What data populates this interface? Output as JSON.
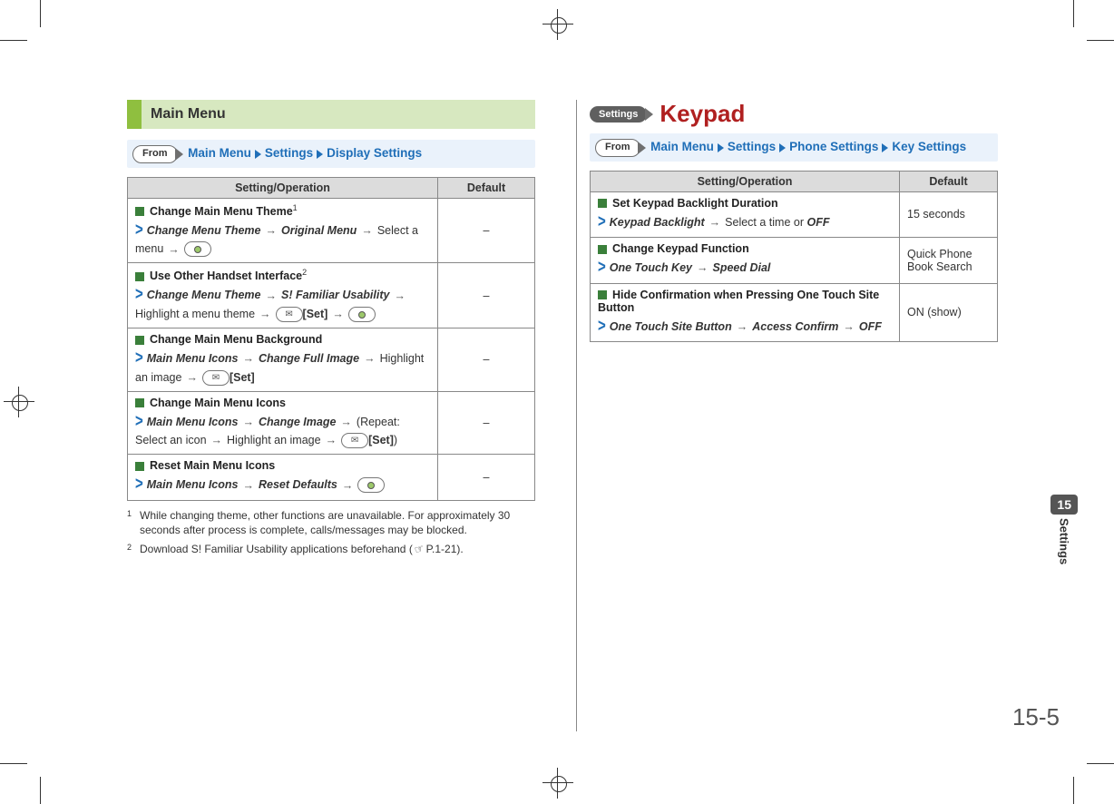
{
  "left": {
    "section_title": "Main Menu",
    "from_label": "From",
    "breadcrumb": [
      "Main Menu",
      "Settings",
      "Display Settings"
    ],
    "table": {
      "headers": [
        "Setting/Operation",
        "Default"
      ],
      "rows": [
        {
          "title": "Change Main Menu Theme",
          "title_sup": "1",
          "path": [
            {
              "t": "Change Menu Theme",
              "s": "bi"
            },
            {
              "t": "→"
            },
            {
              "t": "Original Menu",
              "s": "bi"
            },
            {
              "t": "→"
            },
            {
              "t": "Select a menu"
            },
            {
              "t": "→"
            },
            {
              "t": "[center]",
              "s": "btn-center"
            }
          ],
          "default": "–"
        },
        {
          "title": "Use Other Handset Interface",
          "title_sup": "2",
          "path": [
            {
              "t": "Change Menu Theme",
              "s": "bi"
            },
            {
              "t": "→"
            },
            {
              "t": "S! Familiar Usability",
              "s": "bi"
            },
            {
              "t": "→"
            },
            {
              "t": "Highlight a menu theme"
            },
            {
              "t": "→"
            },
            {
              "t": "[mail]",
              "s": "btn-mail"
            },
            {
              "t": "[Set]",
              "s": "b"
            },
            {
              "t": "→"
            },
            {
              "t": "[center]",
              "s": "btn-center"
            }
          ],
          "default": "–"
        },
        {
          "title": "Change Main Menu Background",
          "path": [
            {
              "t": "Main Menu Icons",
              "s": "bi"
            },
            {
              "t": "→"
            },
            {
              "t": "Change Full Image",
              "s": "bi"
            },
            {
              "t": "→"
            },
            {
              "t": "Highlight an image"
            },
            {
              "t": "→"
            },
            {
              "t": "[mail]",
              "s": "btn-mail"
            },
            {
              "t": "[Set]",
              "s": "b"
            }
          ],
          "default": "–"
        },
        {
          "title": "Change Main Menu Icons",
          "path": [
            {
              "t": "Main Menu Icons",
              "s": "bi"
            },
            {
              "t": "→"
            },
            {
              "t": "Change Image",
              "s": "bi"
            },
            {
              "t": "→"
            },
            {
              "t": "(Repeat: Select an icon"
            },
            {
              "t": "→"
            },
            {
              "t": "Highlight an image"
            },
            {
              "t": "→"
            },
            {
              "t": "[mail]",
              "s": "btn-mail"
            },
            {
              "t": "[Set]",
              "s": "b"
            },
            {
              "t": ")"
            }
          ],
          "default": "–"
        },
        {
          "title": "Reset Main Menu Icons",
          "path": [
            {
              "t": "Main Menu Icons",
              "s": "bi"
            },
            {
              "t": "→"
            },
            {
              "t": "Reset Defaults",
              "s": "bi"
            },
            {
              "t": "→"
            },
            {
              "t": "[center]",
              "s": "btn-center"
            }
          ],
          "default": "–"
        }
      ]
    },
    "footnotes": [
      {
        "num": "1",
        "text_a": "While changing theme, other functions are unavailable. For approximately 30 seconds after process is complete, calls/messages may be blocked."
      },
      {
        "num": "2",
        "text_a": "Download S! Familiar Usability applications beforehand (",
        "hand": true,
        "text_b": "P.1-21)."
      }
    ]
  },
  "right": {
    "settings_pill": "Settings",
    "page_title": "Keypad",
    "from_label": "From",
    "breadcrumb": [
      "Main Menu",
      "Settings",
      "Phone Settings",
      "Key Settings"
    ],
    "table": {
      "headers": [
        "Setting/Operation",
        "Default"
      ],
      "rows": [
        {
          "title": "Set Keypad Backlight Duration",
          "path": [
            {
              "t": "Keypad Backlight",
              "s": "bi"
            },
            {
              "t": "→"
            },
            {
              "t": "Select a time or "
            },
            {
              "t": "OFF",
              "s": "bi"
            }
          ],
          "default": "15 seconds"
        },
        {
          "title": "Change Keypad Function",
          "path": [
            {
              "t": "One Touch Key",
              "s": "bi"
            },
            {
              "t": "→"
            },
            {
              "t": "Speed Dial",
              "s": "bi"
            }
          ],
          "default": "Quick Phone Book Search"
        },
        {
          "title": "Hide Confirmation when Pressing One Touch Site Button",
          "path": [
            {
              "t": "One Touch Site Button",
              "s": "bi"
            },
            {
              "t": "→"
            },
            {
              "t": "Access Confirm",
              "s": "bi"
            },
            {
              "t": "→"
            },
            {
              "t": "OFF",
              "s": "bi"
            }
          ],
          "default": "ON (show)"
        }
      ]
    }
  },
  "side": {
    "chip": "15",
    "text": "Settings"
  },
  "page_number": "15-5"
}
